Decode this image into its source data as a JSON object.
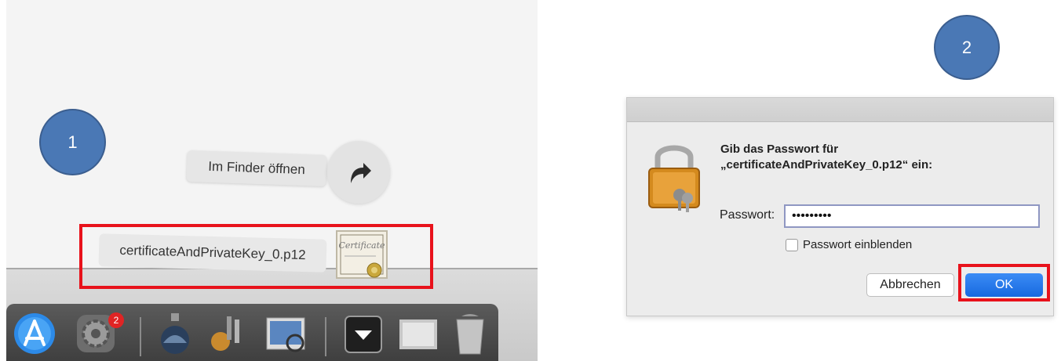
{
  "steps": {
    "step1": "1",
    "step2": "2"
  },
  "finder": {
    "open_label": "Im Finder öffnen"
  },
  "download": {
    "file_name": "certificateAndPrivateKey_0.p12",
    "cert_icon_text": "Certificate"
  },
  "dock": {
    "badge_count": "2"
  },
  "dialog": {
    "message_line1": "Gib das Passwort für",
    "message_line2": "„certificateAndPrivateKey_0.p12“ ein:",
    "password_label": "Passwort:",
    "password_value": "•••••••••",
    "show_password_label": "Passwort einblenden",
    "cancel_label": "Abbrechen",
    "ok_label": "OK"
  },
  "colors": {
    "highlight": "#e8121b",
    "step_circle": "#4a78b5",
    "ok_button": "#1a6fe6"
  },
  "icons": [
    "share-arrow-icon",
    "certificate-icon",
    "app-store-icon",
    "system-preferences-icon",
    "keychain-icon",
    "preview-icon",
    "downloads-stack-icon",
    "trash-icon",
    "padlock-keys-icon"
  ]
}
